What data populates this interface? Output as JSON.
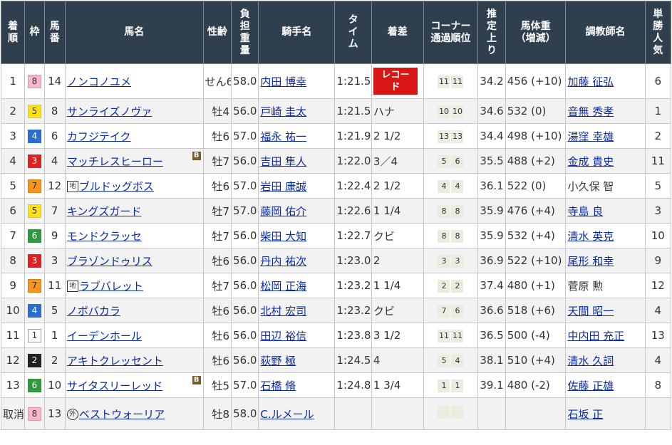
{
  "headers": [
    "着順",
    "枠",
    "馬番",
    "馬名",
    "性齢",
    "負担重量",
    "騎手名",
    "タイム",
    "着差",
    "コーナー通過順位",
    "推定上り",
    "馬体重（増減）",
    "調教師名",
    "単勝人気"
  ],
  "rows": [
    {
      "pos": "1",
      "waku": "8",
      "num": "14",
      "horse": "ノンコノユメ",
      "prefix": "",
      "blinker": "",
      "sex": "せん6",
      "wt": "58.0",
      "jockey": "内田 博幸",
      "time": "1:21.5",
      "margin": "",
      "record": "レコード",
      "c1": "11",
      "c2": "11",
      "last3f": "34.2",
      "bw": "456 (+10)",
      "trainer": "加藤 征弘",
      "trainer_link": true,
      "pop": "6"
    },
    {
      "pos": "2",
      "waku": "5",
      "num": "8",
      "horse": "サンライズノヴァ",
      "prefix": "",
      "blinker": "",
      "sex": "牡4",
      "wt": "56.0",
      "jockey": "戸崎 圭太",
      "time": "1:21.5",
      "margin": "ハナ",
      "record": "",
      "c1": "10",
      "c2": "10",
      "last3f": "34.6",
      "bw": "532 (0)",
      "trainer": "音無 秀孝",
      "trainer_link": true,
      "pop": "1"
    },
    {
      "pos": "3",
      "waku": "4",
      "num": "6",
      "horse": "カフジテイク",
      "prefix": "",
      "blinker": "",
      "sex": "牡6",
      "wt": "57.0",
      "jockey": "福永 祐一",
      "time": "1:21.9",
      "margin": "2 1/2",
      "record": "",
      "c1": "13",
      "c2": "13",
      "last3f": "34.4",
      "bw": "498 (+10)",
      "trainer": "湯窪 幸雄",
      "trainer_link": true,
      "pop": "2"
    },
    {
      "pos": "4",
      "waku": "3",
      "num": "4",
      "horse": "マッチレスヒーロー",
      "prefix": "",
      "blinker": "B",
      "sex": "牡7",
      "wt": "56.0",
      "jockey": "吉田 隼人",
      "time": "1:22.0",
      "margin": "3／4",
      "record": "",
      "c1": "5",
      "c2": "6",
      "last3f": "35.5",
      "bw": "488 (+2)",
      "trainer": "金成 貴史",
      "trainer_link": true,
      "pop": "11"
    },
    {
      "pos": "5",
      "waku": "7",
      "num": "12",
      "horse": "ブルドッグボス",
      "prefix": "地",
      "blinker": "",
      "sex": "牡6",
      "wt": "57.0",
      "jockey": "岩田 康誠",
      "time": "1:22.4",
      "margin": "2 1/2",
      "record": "",
      "c1": "4",
      "c2": "4",
      "last3f": "36.1",
      "bw": "522 (0)",
      "trainer": "小久保 智",
      "trainer_link": false,
      "pop": "5"
    },
    {
      "pos": "6",
      "waku": "5",
      "num": "7",
      "horse": "キングズガード",
      "prefix": "",
      "blinker": "",
      "sex": "牡7",
      "wt": "57.0",
      "jockey": "藤岡 佑介",
      "time": "1:22.6",
      "margin": "1 1/4",
      "record": "",
      "c1": "8",
      "c2": "8",
      "last3f": "35.9",
      "bw": "476 (+4)",
      "trainer": "寺島 良",
      "trainer_link": true,
      "pop": "3"
    },
    {
      "pos": "7",
      "waku": "6",
      "num": "9",
      "horse": "モンドクラッセ",
      "prefix": "",
      "blinker": "",
      "sex": "牡7",
      "wt": "56.0",
      "jockey": "柴田 大知",
      "time": "1:22.7",
      "margin": "クビ",
      "record": "",
      "c1": "8",
      "c2": "8",
      "last3f": "35.9",
      "bw": "532 (+4)",
      "trainer": "清水 英克",
      "trainer_link": true,
      "pop": "10"
    },
    {
      "pos": "8",
      "waku": "3",
      "num": "3",
      "horse": "ブラゾンドゥリス",
      "prefix": "",
      "blinker": "",
      "sex": "牡6",
      "wt": "56.0",
      "jockey": "丹内 祐次",
      "time": "1:23.0",
      "margin": "2",
      "record": "",
      "c1": "3",
      "c2": "3",
      "last3f": "36.9",
      "bw": "522 (+10)",
      "trainer": "尾形 和幸",
      "trainer_link": true,
      "pop": "9"
    },
    {
      "pos": "9",
      "waku": "7",
      "num": "11",
      "horse": "ラブバレット",
      "prefix": "地",
      "blinker": "",
      "sex": "牡7",
      "wt": "56.0",
      "jockey": "松岡 正海",
      "time": "1:23.2",
      "margin": "1 1/4",
      "record": "",
      "c1": "2",
      "c2": "2",
      "last3f": "37.4",
      "bw": "480 (+1)",
      "trainer": "菅原 勲",
      "trainer_link": false,
      "pop": "12"
    },
    {
      "pos": "10",
      "waku": "4",
      "num": "5",
      "horse": "ノボバカラ",
      "prefix": "",
      "blinker": "",
      "sex": "牡6",
      "wt": "56.0",
      "jockey": "北村 宏司",
      "time": "1:23.2",
      "margin": "クビ",
      "record": "",
      "c1": "7",
      "c2": "6",
      "last3f": "36.6",
      "bw": "518 (+6)",
      "trainer": "天間 昭一",
      "trainer_link": true,
      "pop": "4"
    },
    {
      "pos": "11",
      "waku": "1",
      "num": "1",
      "horse": "イーデンホール",
      "prefix": "",
      "blinker": "",
      "sex": "牡6",
      "wt": "56.0",
      "jockey": "田辺 裕信",
      "time": "1:23.8",
      "margin": "3 1/2",
      "record": "",
      "c1": "11",
      "c2": "11",
      "last3f": "36.5",
      "bw": "500 (-4)",
      "trainer": "中内田 充正",
      "trainer_link": true,
      "pop": "13"
    },
    {
      "pos": "12",
      "waku": "2",
      "num": "2",
      "horse": "アキトクレッセント",
      "prefix": "",
      "blinker": "",
      "sex": "牡6",
      "wt": "56.0",
      "jockey": "荻野 極",
      "time": "1:24.5",
      "margin": "4",
      "record": "",
      "c1": "5",
      "c2": "4",
      "last3f": "38.1",
      "bw": "510 (+4)",
      "trainer": "清水 久詞",
      "trainer_link": true,
      "pop": "4"
    },
    {
      "pos": "13",
      "waku": "6",
      "num": "10",
      "horse": "サイタスリーレッド",
      "prefix": "",
      "blinker": "B",
      "sex": "牡5",
      "wt": "57.0",
      "jockey": "石橋 脩",
      "time": "1:24.8",
      "margin": "1 3/4",
      "record": "",
      "c1": "1",
      "c2": "1",
      "last3f": "39.1",
      "bw": "480 (-2)",
      "trainer": "佐藤 正雄",
      "trainer_link": true,
      "pop": "8"
    },
    {
      "pos": "取消",
      "waku": "8",
      "num": "13",
      "horse": "ベストウォーリア",
      "prefix": "外",
      "blinker": "",
      "sex": "牡8",
      "wt": "58.0",
      "jockey": "C.ルメール",
      "time": "",
      "margin": "",
      "record": "",
      "c1": "",
      "c2": "",
      "last3f": "",
      "bw": "",
      "trainer": "石坂 正",
      "trainer_link": true,
      "pop": ""
    }
  ]
}
